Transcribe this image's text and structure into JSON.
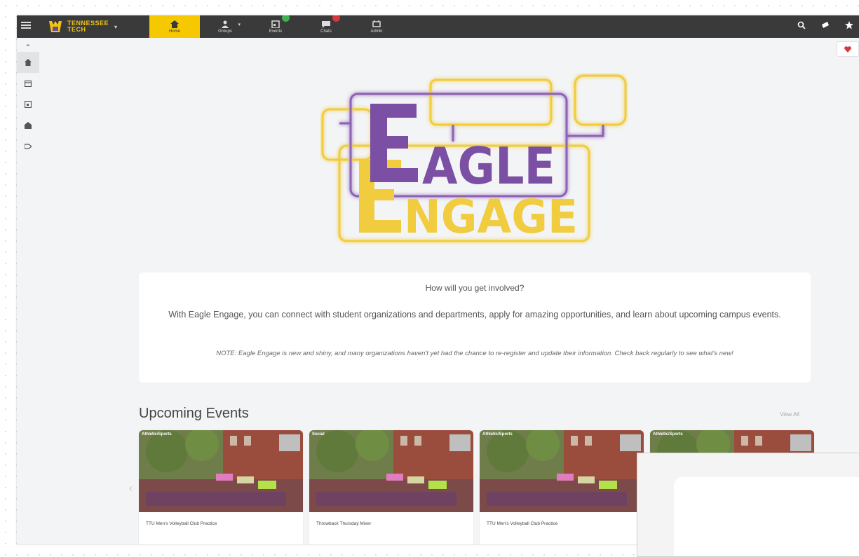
{
  "topbar": {
    "brand": {
      "line1": "TENNESSEE",
      "line2": "TECH"
    },
    "nav": [
      {
        "label": "Home",
        "icon": "home-icon",
        "active": true
      },
      {
        "label": "Groups",
        "icon": "groups-icon",
        "active": false
      },
      {
        "label": "Events",
        "icon": "events-icon",
        "active": false
      },
      {
        "label": "Chats",
        "icon": "chats-icon",
        "active": false
      },
      {
        "label": "Admin",
        "icon": "admin-icon",
        "active": false
      }
    ]
  },
  "rail": {
    "items": [
      "home-icon",
      "calendar-icon",
      "events-icon",
      "building-icon",
      "tag-icon"
    ]
  },
  "hero": {
    "line1": "EAGLE",
    "line2": "ENGAGE"
  },
  "intro": {
    "question": "How will you get involved?",
    "body": "With Eagle Engage, you can connect with student organizations and departments, apply for amazing opportunities, and learn about upcoming campus events.",
    "note": "NOTE: Eagle Engage is new and shiny, and many organizations haven't yet had the chance to re-register and update their information. Check back regularly to see what's new!"
  },
  "events": {
    "title": "Upcoming Events",
    "view_all": "View All",
    "cards": [
      {
        "category": "Athletic/Sports",
        "title": "TTU Men's Volleyball Club Practice"
      },
      {
        "category": "Social",
        "title": "Throwback Thursday Mixer"
      },
      {
        "category": "Athletic/Sports",
        "title": "TTU Men's Volleyball Club Practice"
      },
      {
        "category": "Athletic/Sports",
        "title": ""
      }
    ]
  },
  "colors": {
    "gold": "#f5c800",
    "purple": "#7b4fa3",
    "nav_bg": "#3a3a3a"
  }
}
